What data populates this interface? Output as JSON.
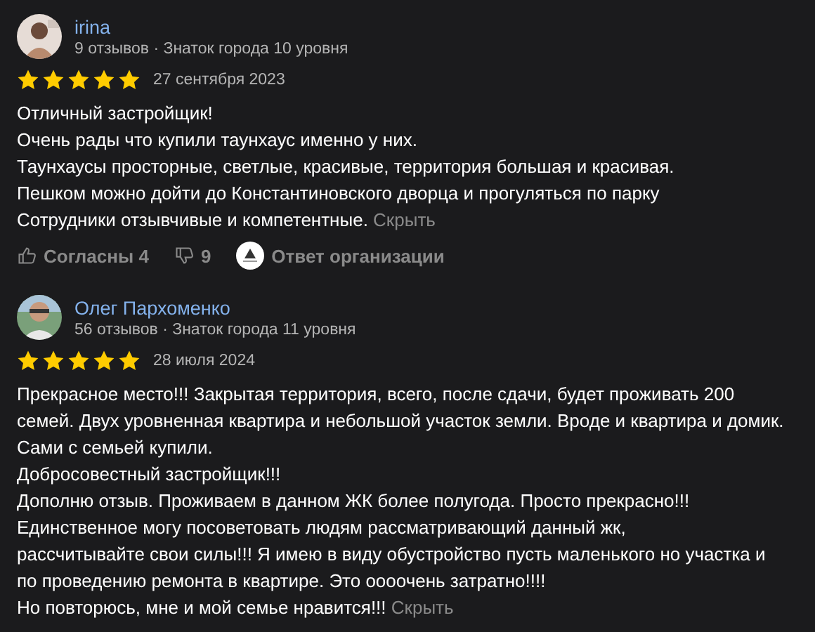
{
  "reviews": [
    {
      "author": "irina",
      "meta": "9 отзывов · Знаток города 10 уровня",
      "stars": 5,
      "date": "27 сентября 2023",
      "text": "Отличный застройщик!\nОчень рады что купили таунхаус именно у них.\nТаунхаусы просторные, светлые, красивые, территория большая и красивая.\nПешком можно дойти до Константиновского дворца и прогуляться по парку\nСотрудники отзывчивые и компетентные.",
      "hide": "Скрыть",
      "likes": "Согласны 4",
      "dislikes": "9",
      "reply": "Ответ организации"
    },
    {
      "author": "Олег Пархоменко",
      "meta": "56 отзывов · Знаток города 11 уровня",
      "stars": 5,
      "date": "28 июля 2024",
      "text": "Прекрасное место!!! Закрытая территория, всего, после сдачи, будет проживать 200 семей. Двух уровненная квартира и небольшой участок земли. Вроде и квартира и домик. Сами с семьей купили.\nДобросовестный застройщик!!!\nДополню отзыв. Проживаем в данном ЖК более полугода. Просто прекрасно!!!\nЕдинственное могу посоветовать людям рассматривающий данный жк,\nрассчитывайте свои силы!!! Я имею в виду обустройство пусть маленького но участка и по проведению ремонта в квартире. Это оооочень затратно!!!!\nНо повторюсь, мне и мой семье нравится!!!",
      "hide": "Скрыть"
    }
  ]
}
